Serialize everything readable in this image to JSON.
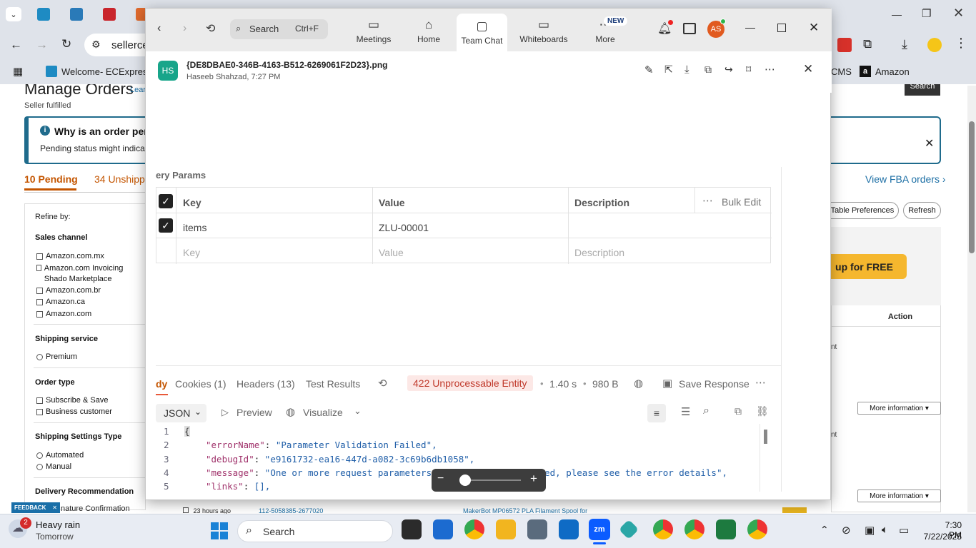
{
  "browser": {
    "address_text": "sellerce",
    "bookmarks": [
      {
        "label": "Welcome- ECExpres..."
      },
      {
        "label": "CMS"
      },
      {
        "label": "Amazon"
      }
    ]
  },
  "seller_page": {
    "title": "Manage Orders",
    "learn_link": "Lear",
    "subtitle": "Seller fulfilled",
    "search_button": "Search",
    "info_title": "Why is an order pen",
    "info_text": "Pending status might indicate a",
    "tabs": [
      {
        "label": "10 Pending"
      },
      {
        "label": "34 Unshipp"
      }
    ],
    "view_fba": "View FBA orders ›",
    "table_prefs_button": "t Table Preferences",
    "refresh_button": "Refresh",
    "promo_button": "up for FREE",
    "action_header": "Action",
    "side_texts": [
      "nt",
      "nt"
    ],
    "more_info": [
      "More information ▾",
      "More information ▾"
    ],
    "refine": {
      "title": "Refine by:",
      "sales_channel": {
        "heading": "Sales channel",
        "items": [
          "Amazon.com.mx",
          "Amazon.com Invoicing Shado Marketplace",
          "Amazon.com.br",
          "Amazon.ca",
          "Amazon.com"
        ]
      },
      "shipping_service": {
        "heading": "Shipping service",
        "items": [
          "Premium"
        ]
      },
      "order_type": {
        "heading": "Order type",
        "items": [
          "Subscribe & Save",
          "Business customer"
        ]
      },
      "shipping_settings": {
        "heading": "Shipping Settings Type",
        "items": [
          "Automated",
          "Manual"
        ]
      },
      "delivery": {
        "heading": "Delivery Recommendation",
        "item": "nature Confirmation"
      }
    },
    "feedback": "FEEDBACK",
    "bottom_row": {
      "time": "23 hours ago",
      "order_id": "112-5058385-2677020",
      "product": "MakerBot MP06572 PLA Filament Spool for"
    }
  },
  "zoom": {
    "search_placeholder": "Search",
    "search_shortcut": "Ctrl+F",
    "nav": [
      {
        "label": "Meetings",
        "icon": "video-icon"
      },
      {
        "label": "Home",
        "icon": "home-icon"
      },
      {
        "label": "Team Chat",
        "icon": "chat-icon"
      },
      {
        "label": "Whiteboards",
        "icon": "whiteboard-icon"
      },
      {
        "label": "More",
        "icon": "more-icon"
      }
    ],
    "new_badge": "NEW",
    "avatar": "AS",
    "file": {
      "avatar": "HS",
      "name": "{DE8DBAE0-346B-4163-B512-6269061F2D23}.png",
      "meta": "Haseeb Shahzad, 7:27 PM"
    }
  },
  "postman": {
    "section_title": "ery Params",
    "headers": {
      "key": "Key",
      "value": "Value",
      "description": "Description",
      "bulk_edit": "Bulk Edit"
    },
    "row": {
      "key": "items",
      "value": "ZLU-00001"
    },
    "placeholder_row": {
      "key": "Key",
      "value": "Value",
      "description": "Description"
    },
    "response_tabs": [
      "dy",
      "Cookies (1)",
      "Headers (13)",
      "Test Results"
    ],
    "status": "422 Unprocessable Entity",
    "time": "1.40 s",
    "size": "980 B",
    "save_response": "Save Response",
    "format": "JSON",
    "preview": "Preview",
    "visualize": "Visualize",
    "code_lines": [
      {
        "n": "1",
        "key": "",
        "val": "{"
      },
      {
        "n": "2",
        "key": "\"errorName\"",
        "val": "\"Parameter Validation Failed\","
      },
      {
        "n": "3",
        "key": "\"debugId\"",
        "val": "\"e9161732-ea16-447d-a082-3c69b6db1058\","
      },
      {
        "n": "4",
        "key": "\"message\"",
        "val": "\"One or more request parameters could not be validated, please see the error details\","
      },
      {
        "n": "5",
        "key": "\"links\"",
        "val": "[],"
      }
    ]
  },
  "taskbar": {
    "weather_badge": "2",
    "weather_title": "Heavy rain",
    "weather_sub": "Tomorrow",
    "search": "Search",
    "time": "7:30 PM",
    "date": "7/22/2025"
  }
}
